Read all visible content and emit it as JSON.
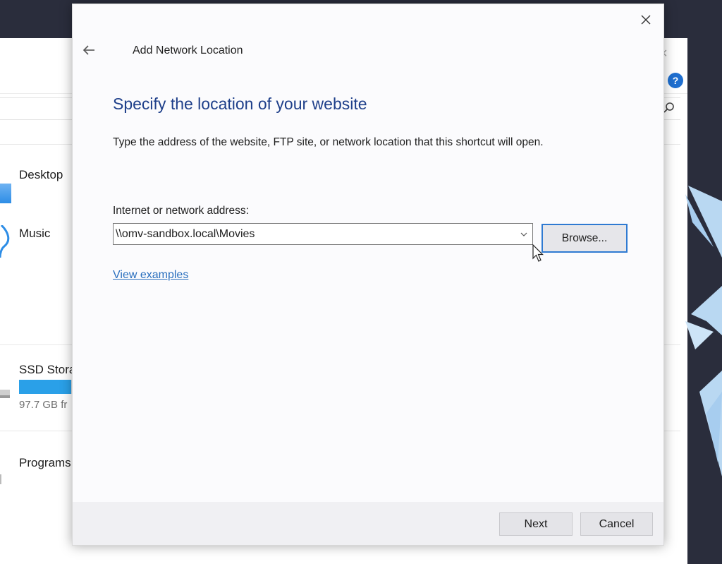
{
  "background": {
    "quick_access": [
      {
        "label": "Desktop"
      },
      {
        "label": "Music"
      }
    ],
    "drive": {
      "label": "SSD Stora",
      "free_text": "97.7 GB fr",
      "used_fraction": 0.92
    },
    "programs_label": "Programs",
    "help_icon_glyph": "?"
  },
  "dialog": {
    "title": "Add Network Location",
    "heading": "Specify the location of your website",
    "description": "Type the address of the website, FTP site, or network location that this shortcut will open.",
    "field_label": "Internet or network address:",
    "address_value": "\\\\omv-sandbox.local\\Movies",
    "browse_label": "Browse...",
    "examples_link": "View examples",
    "next_label": "Next",
    "cancel_label": "Cancel"
  },
  "colors": {
    "heading": "#1e3f8a",
    "link": "#2a6fbe",
    "focus_border": "#2f7ad2"
  }
}
